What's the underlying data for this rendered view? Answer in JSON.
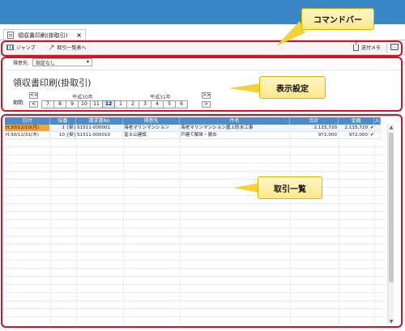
{
  "tab": {
    "label": "領収書印刷(掛取引)",
    "close": "×"
  },
  "command_bar": {
    "jump_label": "ジャンプ",
    "back_label": "取引一覧表へ",
    "export_label": "送付メモ"
  },
  "filter": {
    "payee_label": "得意先:",
    "payee_value": "指定なし"
  },
  "page_title": "領収書印刷(掛取引)",
  "period": {
    "label": "期間:",
    "era_left": "平成30年",
    "era_right": "平成31年",
    "prev_button": "<<",
    "prev_small": "<",
    "next_button": ">>",
    "next_small": ">",
    "months": [
      "7",
      "8",
      "9",
      "10",
      "11",
      "12",
      "1",
      "2",
      "3",
      "4",
      "5",
      "6"
    ],
    "selected_month": "12"
  },
  "table": {
    "headers": [
      "日付",
      "伝番",
      "請求書No",
      "得意先",
      "件名",
      "合計",
      "金額",
      "入"
    ],
    "rows": [
      {
        "date": "H.30/12/10(月)",
        "slip": "1",
        "type": "[掛]",
        "invoice": "S1511-000001",
        "customer": "海老マリンマンション",
        "subject": "海老マリンマンション屋上防水工事",
        "total": "2,115,720",
        "amount": "2,115,720",
        "check": "✔"
      },
      {
        "date": "H.30/12/31(木)",
        "slip": "10",
        "type": "[掛]",
        "invoice": "S1511-000010",
        "customer": "富士山建設",
        "subject": "戸建て解体・撤去",
        "total": "972,000",
        "amount": "972,000",
        "check": "✔"
      }
    ]
  },
  "callouts": {
    "command_bar": "コマンドバー",
    "display_settings": "表示設定",
    "transaction_list": "取引一覧"
  },
  "colors": {
    "title_bar": "#3b86c6",
    "header": "#4d8bc9",
    "highlight": "#d0142a",
    "callout": "#ffe88a"
  }
}
